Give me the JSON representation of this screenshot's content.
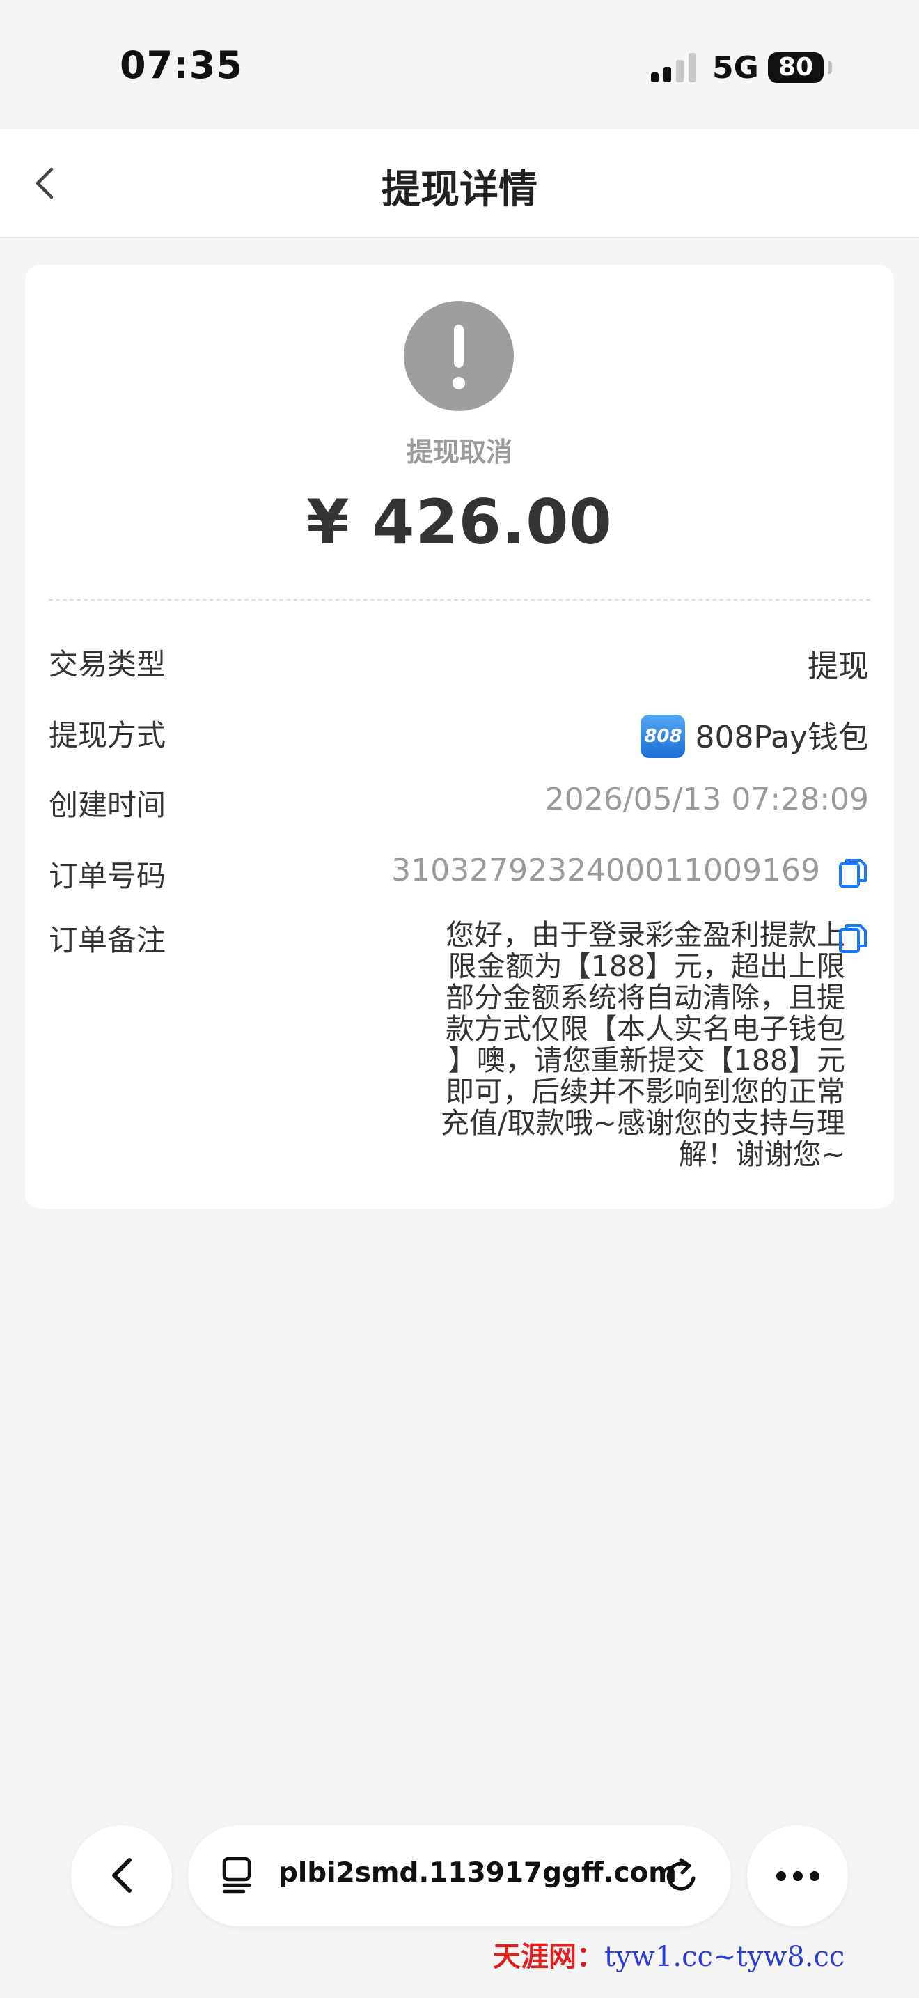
{
  "status_bar": {
    "time": "07:35",
    "network": "5G",
    "battery": "80"
  },
  "header": {
    "title": "提现详情",
    "back_icon": "chevron-left-icon"
  },
  "summary": {
    "status_icon": "exclamation-circle-icon",
    "status_text": "提现取消",
    "amount": "¥ 426.00"
  },
  "details": {
    "type": {
      "label": "交易类型",
      "value": "提现"
    },
    "method": {
      "label": "提现方式",
      "value": "808Pay钱包",
      "logo_text": "808"
    },
    "created": {
      "label": "创建时间",
      "value": "2026/05/13 07:28:09"
    },
    "order": {
      "label": "订单号码",
      "value": "3103279232400011009169",
      "copy_icon": "copy-icon"
    },
    "remark": {
      "label": "订单备注",
      "lines": [
        "您好，由于登录彩金盈利提款上",
        "限金额为【188】元，超出上限",
        "部分金额系统将自动清除，且提",
        "款方式仅限【本人实名电子钱包",
        "】噢，请您重新提交【188】元",
        "即可，后续并不影响到您的正常",
        "充值/取款哦~感谢您的支持与理",
        "解！谢谢您~"
      ],
      "copy_icon": "copy-icon"
    }
  },
  "browser_bar": {
    "url": "plbi2smd.113917ggff.com",
    "back_icon": "chevron-left-icon",
    "tabs_icon": "tab-icon",
    "reload_icon": "reload-icon",
    "more_icon": "more-icon"
  },
  "watermark": {
    "site": "天涯网：",
    "urls": "tyw1.cc~tyw8.cc"
  },
  "colors": {
    "accent_blue": "#1677ff",
    "status_grey": "#9e9e9e",
    "watermark_red": "#e02020",
    "watermark_blue": "#2a3dd6"
  }
}
